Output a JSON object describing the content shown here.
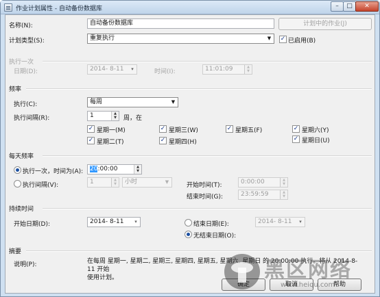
{
  "window": {
    "title": "作业计划属性 - 自动备份数据库",
    "min_glyph": "–",
    "max_glyph": "□",
    "close_glyph": "✕"
  },
  "name": {
    "label": "名称(N):",
    "value": "自动备份数据库",
    "jobs_button": "计划中的作业(J)"
  },
  "schedule_type": {
    "label": "计划类型(S):",
    "value": "重复执行",
    "enabled_label": "已启用(B)",
    "enabled": true
  },
  "once": {
    "section": "执行一次",
    "date_label": "日期(D):",
    "date_value": "2014- 8-11",
    "time_label": "时间(I):",
    "time_value": "11:01:09"
  },
  "frequency": {
    "section": "频率",
    "occurs_label": "执行(C):",
    "occurs_value": "每周",
    "recurs_label": "执行间隔(R):",
    "recurs_value": "1",
    "recurs_unit": "周，在",
    "days": [
      {
        "label": "星期一(M)",
        "checked": true
      },
      {
        "label": "星期三(W)",
        "checked": true
      },
      {
        "label": "星期五(F)",
        "checked": true
      },
      {
        "label": "星期六(Y)",
        "checked": true
      },
      {
        "label": "星期二(T)",
        "checked": true
      },
      {
        "label": "星期四(H)",
        "checked": true
      },
      {
        "label": "星期日(U)",
        "checked": true
      }
    ]
  },
  "daily": {
    "section": "每天频率",
    "once_label": "执行一次，时间为(A):",
    "once_value_hl": "20",
    "once_value_rest": ":00:00",
    "interval_label": "执行间隔(V):",
    "interval_value": "1",
    "interval_unit": "小时",
    "start_label": "开始时间(T):",
    "start_value": "0:00:00",
    "end_label": "结束时间(G):",
    "end_value": "23:59:59"
  },
  "duration": {
    "section": "持续时间",
    "start_label": "开始日期(D):",
    "start_value": "2014- 8-11",
    "end_label": "结束日期(E):",
    "end_value": "2014- 8-11",
    "no_end_label": "无结束日期(O):"
  },
  "summary": {
    "section": "摘要",
    "desc_label": "说明(P):",
    "desc_line1": "在每周 星期一, 星期二, 星期三, 星期四, 星期五, 星期六, 星期日 的 20:00:00 执行。将从 2014-8-11 开始",
    "desc_line2": "使用计划。"
  },
  "footer": {
    "ok": "确定",
    "cancel": "取消",
    "help": "帮助"
  },
  "watermark": {
    "text": "黑区网络",
    "url": "www.heiqu.com"
  },
  "colors": {
    "title_gradient_top": "#dce9f7",
    "client_bg": "#f0f0f0",
    "selection": "#3399ff"
  }
}
